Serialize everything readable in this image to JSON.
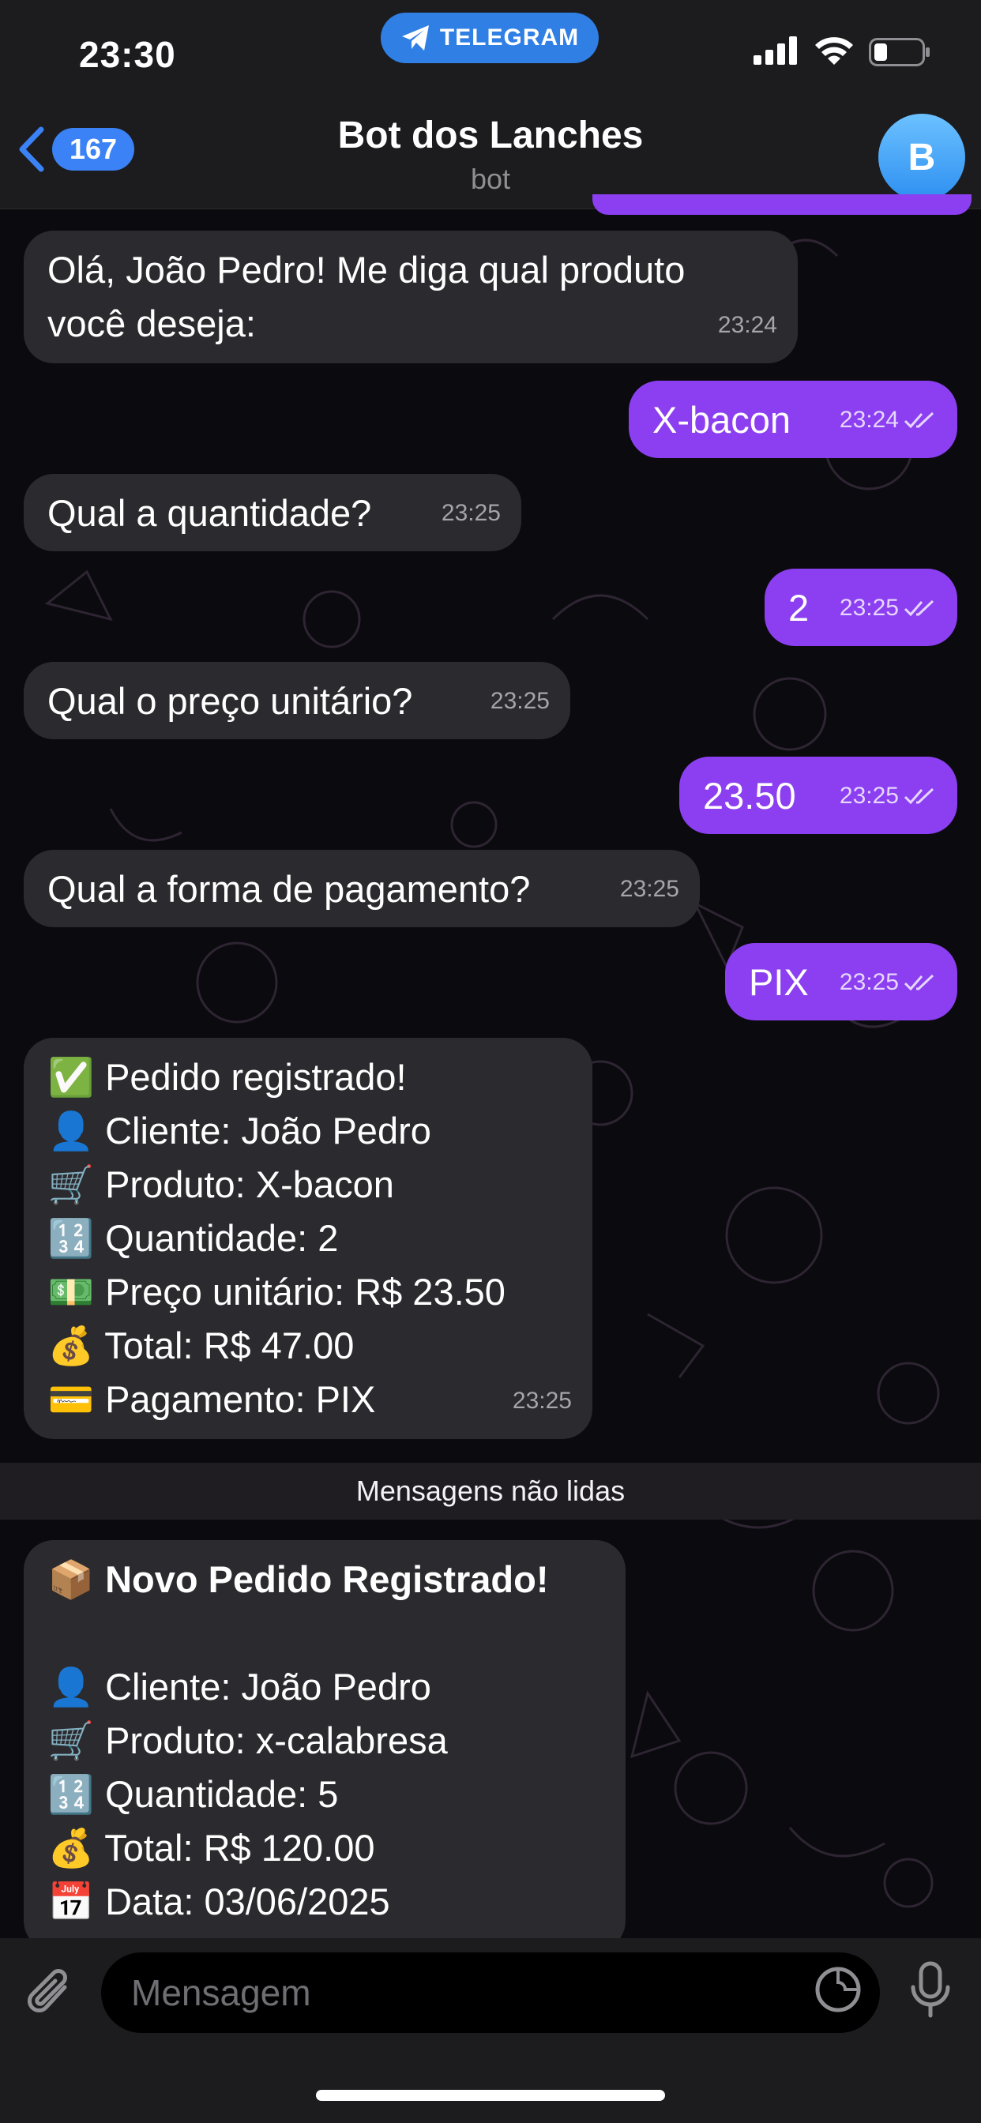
{
  "status_bar": {
    "time": "23:30",
    "app_pill": "TELEGRAM"
  },
  "header": {
    "back_count": "167",
    "title": "Bot dos Lanches",
    "subtitle": "bot",
    "avatar_letter": "B"
  },
  "messages": [
    {
      "dir": "in",
      "lines": [
        "Olá, João Pedro! Me diga qual produto",
        "você deseja:"
      ],
      "time": "23:24"
    },
    {
      "dir": "out",
      "text": "X-bacon",
      "time": "23:24",
      "status": "read"
    },
    {
      "dir": "in",
      "text": "Qual a quantidade?",
      "time": "23:25"
    },
    {
      "dir": "out",
      "text": "2",
      "time": "23:25",
      "status": "read"
    },
    {
      "dir": "in",
      "text": "Qual o preço unitário?",
      "time": "23:25"
    },
    {
      "dir": "out",
      "text": "23.50",
      "time": "23:25",
      "status": "read"
    },
    {
      "dir": "in",
      "text": "Qual a forma de pagamento?",
      "time": "23:25"
    },
    {
      "dir": "out",
      "text": "PIX",
      "time": "23:25",
      "status": "read"
    },
    {
      "dir": "in",
      "time": "23:25",
      "lines": [
        {
          "emoji": "✅",
          "text": "Pedido registrado!"
        },
        {
          "emoji": "👤",
          "text": "Cliente: João Pedro"
        },
        {
          "emoji": "🛒",
          "text": "Produto: X-bacon"
        },
        {
          "emoji": "🔢",
          "text": "Quantidade: 2"
        },
        {
          "emoji": "💵",
          "text": "Preço unitário: R$ 23.50"
        },
        {
          "emoji": "💰",
          "text": "Total: R$ 47.00"
        },
        {
          "emoji": "💳",
          "text": "Pagamento: PIX"
        }
      ]
    }
  ],
  "unread_divider": "Mensagens não lidas",
  "new_order": {
    "title_emoji": "📦",
    "title": "Novo Pedido Registrado!",
    "lines": [
      {
        "emoji": "👤",
        "text": "Cliente: João Pedro"
      },
      {
        "emoji": "🛒",
        "text": "Produto: x-calabresa"
      },
      {
        "emoji": "🔢",
        "text": "Quantidade: 5"
      },
      {
        "emoji": "💰",
        "text": "Total: R$ 120.00"
      },
      {
        "emoji": "📅",
        "text": "Data: 03/06/2025"
      }
    ]
  },
  "input": {
    "placeholder": "Mensagem"
  },
  "colors": {
    "outgoing": "#8b3ff0",
    "incoming": "#2b2a2e",
    "accent": "#3b82f6"
  },
  "icons": [
    "telegram-plane-icon",
    "signal-icon",
    "wifi-icon",
    "battery-icon",
    "back-chevron-icon",
    "read-receipt-icon",
    "paperclip-icon",
    "sticker-icon",
    "microphone-icon"
  ]
}
